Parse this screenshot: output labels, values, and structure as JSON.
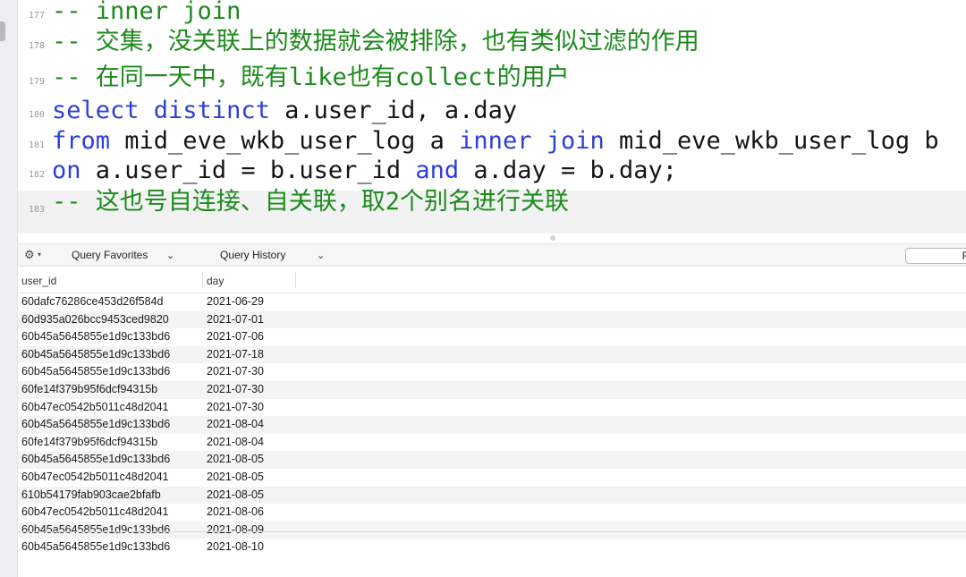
{
  "editor": {
    "lines": [
      {
        "num": "177",
        "segments": [
          {
            "cls": "cmt",
            "text": "-- inner join"
          }
        ]
      },
      {
        "num": "178",
        "segments": [
          {
            "cls": "cmt",
            "text": "-- 交集，没关联上的数据就会被排除，也有类似过滤的作用"
          }
        ]
      },
      {
        "num": "179",
        "segments": [
          {
            "cls": "cmt",
            "text": "-- 在同一天中，既有like也有collect的用户"
          }
        ]
      },
      {
        "num": "180",
        "segments": [
          {
            "cls": "kw",
            "text": "select distinct"
          },
          {
            "cls": "plain",
            "text": " a.user_id, a.day"
          }
        ]
      },
      {
        "num": "181",
        "segments": [
          {
            "cls": "kw",
            "text": "from"
          },
          {
            "cls": "plain",
            "text": " mid_eve_wkb_user_log a "
          },
          {
            "cls": "kw",
            "text": "inner join"
          },
          {
            "cls": "plain",
            "text": " mid_eve_wkb_user_log b"
          }
        ]
      },
      {
        "num": "182",
        "segments": [
          {
            "cls": "kw",
            "text": "on"
          },
          {
            "cls": "plain",
            "text": " a.user_id = b.user_id "
          },
          {
            "cls": "kw",
            "text": "and"
          },
          {
            "cls": "plain",
            "text": " a.day = b.day;"
          }
        ]
      },
      {
        "num": "183",
        "segments": [
          {
            "cls": "cmt",
            "text": "-- 这也号自连接、自关联，取2个别名进行关联"
          }
        ]
      }
    ],
    "highlighted_line": "183"
  },
  "toolbar": {
    "gear_icon": "gear-icon",
    "query_favorites": "Query Favorites",
    "query_history": "Query History",
    "run_label": "Ru"
  },
  "results": {
    "columns": [
      "user_id",
      "day"
    ],
    "rows": [
      [
        "60dafc76286ce453d26f584d",
        "2021-06-29"
      ],
      [
        "60d935a026bcc9453ced9820",
        "2021-07-01"
      ],
      [
        "60b45a5645855e1d9c133bd6",
        "2021-07-06"
      ],
      [
        "60b45a5645855e1d9c133bd6",
        "2021-07-18"
      ],
      [
        "60b45a5645855e1d9c133bd6",
        "2021-07-30"
      ],
      [
        "60fe14f379b95f6dcf94315b",
        "2021-07-30"
      ],
      [
        "60b47ec0542b5011c48d2041",
        "2021-07-30"
      ],
      [
        "60b45a5645855e1d9c133bd6",
        "2021-08-04"
      ],
      [
        "60fe14f379b95f6dcf94315b",
        "2021-08-04"
      ],
      [
        "60b45a5645855e1d9c133bd6",
        "2021-08-05"
      ],
      [
        "60b47ec0542b5011c48d2041",
        "2021-08-05"
      ],
      [
        "610b54179fab903cae2bfafb",
        "2021-08-05"
      ],
      [
        "60b47ec0542b5011c48d2041",
        "2021-08-06"
      ],
      [
        "60b45a5645855e1d9c133bd6",
        "2021-08-09"
      ],
      [
        "60b45a5645855e1d9c133bd6",
        "2021-08-10"
      ]
    ]
  }
}
